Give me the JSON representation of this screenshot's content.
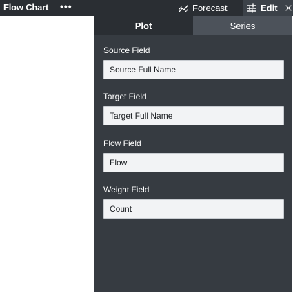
{
  "header": {
    "title": "Flow Chart",
    "more_icon": "more-horizontal-icon",
    "forecast_label": "Forecast",
    "forecast_icon": "forecast-trend-icon",
    "edit_label": "Edit",
    "edit_icon": "tune-sliders-icon",
    "close_icon": "close-icon"
  },
  "panel": {
    "tabs": [
      {
        "label": "Plot",
        "active": true
      },
      {
        "label": "Series",
        "active": false
      }
    ],
    "fields": [
      {
        "label": "Source Field",
        "value": "Source Full Name"
      },
      {
        "label": "Target Field",
        "value": "Target Full Name"
      },
      {
        "label": "Flow Field",
        "value": "Flow"
      },
      {
        "label": "Weight Field",
        "value": "Count"
      }
    ]
  },
  "colors": {
    "topbar": "#2a2e33",
    "panel": "#363b41",
    "inactive_tab": "#4c525a",
    "input_bg": "#f2f3f5"
  }
}
